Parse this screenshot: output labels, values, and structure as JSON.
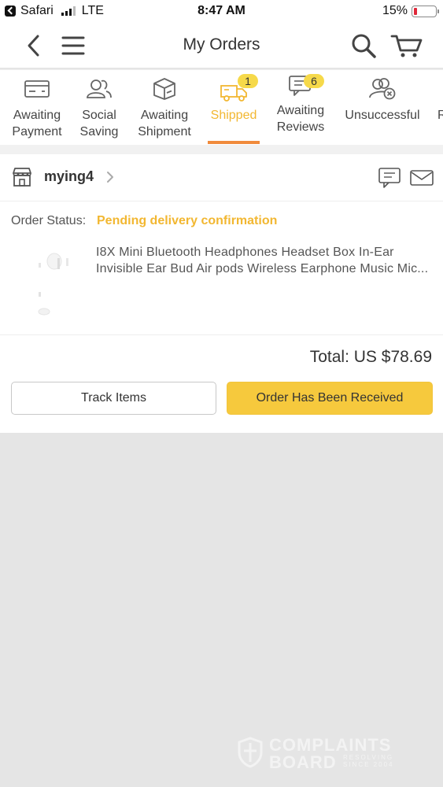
{
  "status_bar": {
    "back_app": "Safari",
    "carrier": "LTE",
    "time": "8:47 AM",
    "battery_percent": "15%",
    "battery_level": 0.15
  },
  "header": {
    "title": "My Orders",
    "icons": [
      "back-arrow-icon",
      "menu-icon",
      "search-icon",
      "cart-icon"
    ]
  },
  "tabs": [
    {
      "label_line1": "Awaiting",
      "label_line2": "Payment",
      "icon": "card-icon"
    },
    {
      "label_line1": "Social",
      "label_line2": "Saving",
      "icon": "people-icon"
    },
    {
      "label_line1": "Awaiting",
      "label_line2": "Shipment",
      "icon": "box-icon"
    },
    {
      "label_line1": "Shipped",
      "label_line2": "",
      "icon": "truck-icon",
      "badge": "1",
      "active": true
    },
    {
      "label_line1": "Awaiting",
      "label_line2": "Reviews",
      "icon": "review-icon",
      "badge": "6"
    },
    {
      "label_line1": "Unsuccessful",
      "label_line2": "",
      "icon": "unsuccessful-icon"
    }
  ],
  "order": {
    "store_name": "mying4",
    "status_label": "Order Status:",
    "status_value": "Pending delivery confirmation",
    "product_title_line1": "I8X Mini Bluetooth Headphones Headset Box In-Ear",
    "product_title_line2": "Invisible Ear Bud Air pods Wireless Earphone Music Mic...",
    "total": "Total: US $78.69",
    "track_button": "Track Items",
    "received_button": "Order Has Been Received"
  },
  "watermark": {
    "line1": "COMPLAINTS",
    "line2": "BOARD",
    "tagline": "RESOLVING SINCE 2004"
  },
  "colors": {
    "accent": "#f2b731",
    "active_underline": "#f08a3c",
    "button_primary": "#f6c93d",
    "badge": "#f6d94a",
    "background": "#e5e5e5"
  }
}
